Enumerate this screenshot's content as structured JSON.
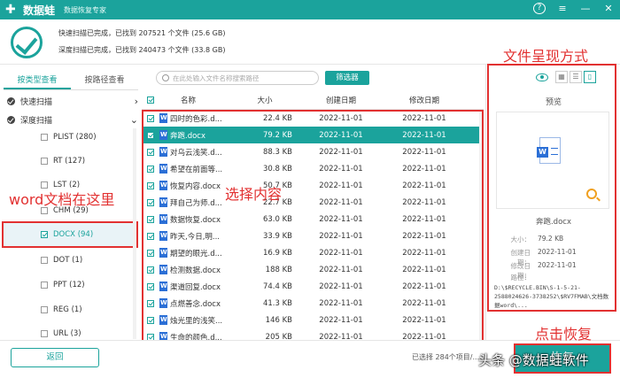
{
  "app": {
    "name": "数据蛙",
    "subtitle": "数据恢复专家",
    "help": "?",
    "menu": "≡",
    "minimize": "—",
    "close": "✕"
  },
  "scan": {
    "quick": "快速扫描已完成，已找到  207521 个文件  (25.6 GB)",
    "deep": "深度扫描已完成，已找到  240473 个文件  (33.8 GB)"
  },
  "left": {
    "tabs": [
      "按类型查看",
      "按路径查看"
    ],
    "groups": [
      "快速扫描",
      "深度扫描"
    ],
    "types": [
      "PLIST (280)",
      "RT (127)",
      "LST (2)",
      "CHM (29)",
      "DOCX (94)",
      "DOT (1)",
      "PPT (12)",
      "REG (1)",
      "URL (3)"
    ]
  },
  "toolbar": {
    "search_placeholder": "在此处输入文件名称搜索路径",
    "filter": "筛选器"
  },
  "table": {
    "headers": [
      "名称",
      "大小",
      "创建日期",
      "修改日期"
    ],
    "rows": [
      {
        "name": "四时的色彩.d...",
        "size": "22.4 KB",
        "created": "2022-11-01",
        "modified": "2022-11-01"
      },
      {
        "name": "奔跑.docx",
        "size": "79.2 KB",
        "created": "2022-11-01",
        "modified": "2022-11-01"
      },
      {
        "name": "对乌云浅笑.d...",
        "size": "88.3 KB",
        "created": "2022-11-01",
        "modified": "2022-11-01"
      },
      {
        "name": "希望在前面等...",
        "size": "30.8 KB",
        "created": "2022-11-01",
        "modified": "2022-11-01"
      },
      {
        "name": "恢复内容.docx",
        "size": "50.7 KB",
        "created": "2022-11-01",
        "modified": "2022-11-01"
      },
      {
        "name": "拜自己为师.d...",
        "size": "22.7 KB",
        "created": "2022-11-01",
        "modified": "2022-11-01"
      },
      {
        "name": "数据恢复.docx",
        "size": "63.0 KB",
        "created": "2022-11-01",
        "modified": "2022-11-01"
      },
      {
        "name": "昨天,今日,明...",
        "size": "33.9 KB",
        "created": "2022-11-01",
        "modified": "2022-11-01"
      },
      {
        "name": "期望的眼光.d...",
        "size": "16.9 KB",
        "created": "2022-11-01",
        "modified": "2022-11-01"
      },
      {
        "name": "检测数据.docx",
        "size": "188 KB",
        "created": "2022-11-01",
        "modified": "2022-11-01"
      },
      {
        "name": "渠道回复.docx",
        "size": "74.4 KB",
        "created": "2022-11-01",
        "modified": "2022-11-01"
      },
      {
        "name": "点燃善念.docx",
        "size": "41.3 KB",
        "created": "2022-11-01",
        "modified": "2022-11-01"
      },
      {
        "name": "烛光里的浅笑...",
        "size": "146 KB",
        "created": "2022-11-01",
        "modified": "2022-11-01"
      },
      {
        "name": "生命的颜色.d...",
        "size": "205 KB",
        "created": "2022-11-01",
        "modified": "2022-11-01"
      }
    ]
  },
  "preview": {
    "title": "预览",
    "filename": "奔跑.docx",
    "size_label": "大小：",
    "size_value": "79.2 KB",
    "created_label": "创建日期：",
    "created_value": "2022-11-01",
    "modified_label": "修改日期：",
    "modified_value": "2022-11-01",
    "path_label": "路径：",
    "path_value": "D:\\$RECYCLE.BIN\\S-1-5-21-2588024626-3738252\\$RV7FMAB\\文档数据word\\..."
  },
  "annotations": {
    "word_here": "word文档在这里",
    "select_content": "选择内容",
    "file_view": "文件呈现方式",
    "click_recover": "点击恢复"
  },
  "bottom": {
    "back": "返回",
    "status": "已选择 284个项目/...",
    "recover": "恢复",
    "watermark": "头条 @数据蛙软件"
  },
  "colors": {
    "accent": "#1ba39c",
    "annotation_red": "#e23131"
  }
}
